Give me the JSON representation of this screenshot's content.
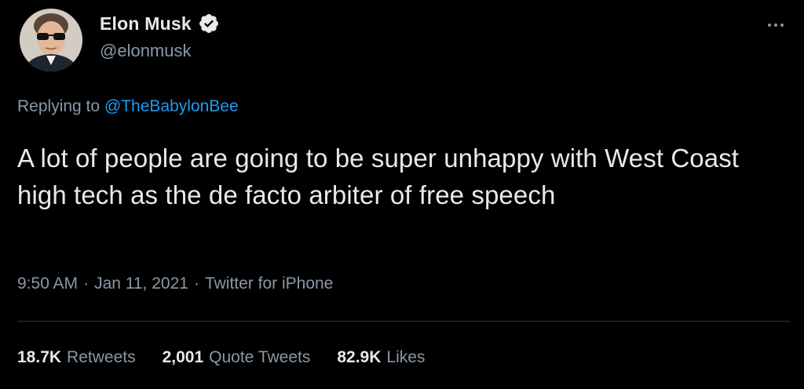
{
  "author": {
    "display_name": "Elon Musk",
    "handle": "@elonmusk",
    "verified": true,
    "avatar_icon": "profile-photo"
  },
  "reply_context": {
    "prefix": "Replying to",
    "mention": "@TheBabylonBee"
  },
  "tweet": {
    "text": "A lot of people are going to be super unhappy with West Coast high tech as the de facto arbiter of free speech"
  },
  "meta": {
    "time": "9:50 AM",
    "separator": "·",
    "date": "Jan 11, 2021",
    "source": "Twitter for iPhone"
  },
  "stats": {
    "retweets_count": "18.7K",
    "retweets_label": "Retweets",
    "quotes_count": "2,001",
    "quotes_label": "Quote Tweets",
    "likes_count": "82.9K",
    "likes_label": "Likes"
  },
  "colors": {
    "background": "#000000",
    "primary_text": "#e7e9ea",
    "secondary_text": "#8b98a5",
    "link": "#1d9bf0",
    "divider": "#2f3336"
  },
  "icons": {
    "verified": "verified-badge-icon",
    "more": "more-options-icon"
  }
}
